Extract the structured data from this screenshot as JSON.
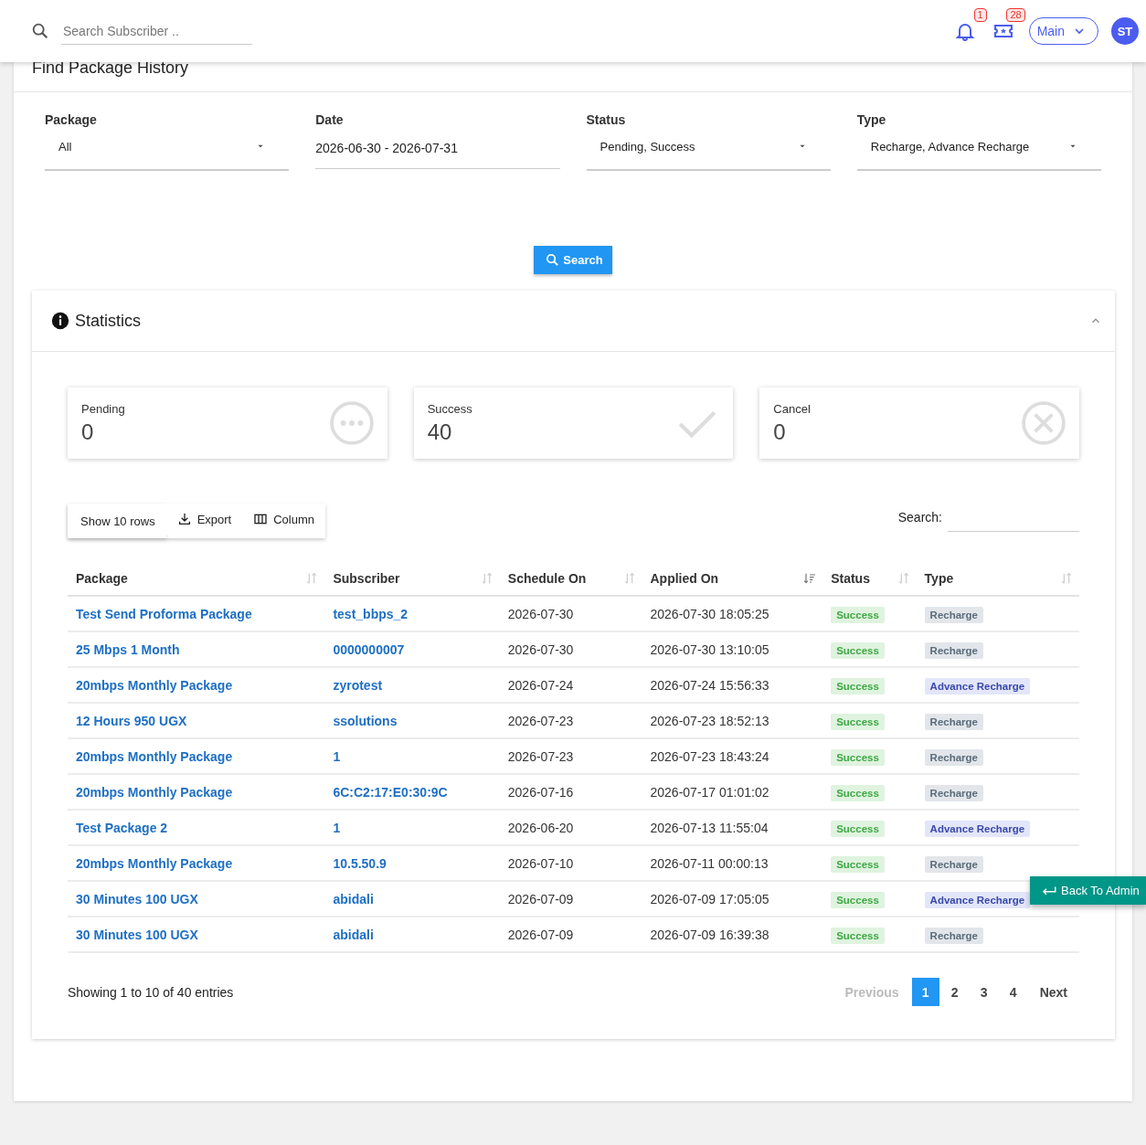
{
  "header": {
    "search": {
      "placeholder": "Search Subscriber .."
    },
    "notifications": "1",
    "tickets": "28",
    "menu": "Main",
    "avatar": "ST"
  },
  "card": {
    "title": "Find Package History"
  },
  "filters": [
    {
      "label": "Package",
      "value": "All",
      "kind": "select"
    },
    {
      "label": "Date",
      "value": "2026-06-30 - 2026-07-31",
      "kind": "text"
    },
    {
      "label": "Status",
      "value": "Pending, Success",
      "kind": "select"
    },
    {
      "label": "Type",
      "value": "Recharge, Advance Recharge",
      "kind": "select"
    }
  ],
  "search_button": "Search",
  "statistics": {
    "title": "Statistics",
    "expanded": true,
    "cards": [
      {
        "label": "Pending",
        "value": "0",
        "kind": "pending"
      },
      {
        "label": "Success",
        "value": "40",
        "kind": "success"
      },
      {
        "label": "Cancel",
        "value": "0",
        "kind": "cancel"
      }
    ]
  },
  "toolbar": {
    "rows": "Show 10 rows",
    "export": "Export",
    "column": "Column",
    "search_label": "Search:"
  },
  "table": {
    "columns": [
      {
        "label": "Package",
        "sorted": false
      },
      {
        "label": "Subscriber",
        "sorted": false
      },
      {
        "label": "Schedule On",
        "sorted": false
      },
      {
        "label": "Applied On",
        "sorted": true
      },
      {
        "label": "Status",
        "sorted": false
      },
      {
        "label": "Type",
        "sorted": false
      }
    ],
    "rows": [
      {
        "package": "Test Send Proforma Package",
        "subscriber": "test_bbps_2",
        "schedule": "2026-07-30",
        "applied": "2026-07-30 18:05:25",
        "status": "Success",
        "type": {
          "label": "Recharge",
          "kind": "recharge"
        }
      },
      {
        "package": "25 Mbps 1 Month",
        "subscriber": "0000000007",
        "schedule": "2026-07-30",
        "applied": "2026-07-30 13:10:05",
        "status": "Success",
        "type": {
          "label": "Recharge",
          "kind": "recharge"
        }
      },
      {
        "package": "20mbps Monthly Package",
        "subscriber": "zyrotest",
        "schedule": "2026-07-24",
        "applied": "2026-07-24 15:56:33",
        "status": "Success",
        "type": {
          "label": "Advance Recharge",
          "kind": "advance"
        }
      },
      {
        "package": "12 Hours 950 UGX",
        "subscriber": "ssolutions",
        "schedule": "2026-07-23",
        "applied": "2026-07-23 18:52:13",
        "status": "Success",
        "type": {
          "label": "Recharge",
          "kind": "recharge"
        }
      },
      {
        "package": "20mbps Monthly Package",
        "subscriber": "1",
        "schedule": "2026-07-23",
        "applied": "2026-07-23 18:43:24",
        "status": "Success",
        "type": {
          "label": "Recharge",
          "kind": "recharge"
        }
      },
      {
        "package": "20mbps Monthly Package",
        "subscriber": "6C:C2:17:E0:30:9C",
        "schedule": "2026-07-16",
        "applied": "2026-07-17 01:01:02",
        "status": "Success",
        "type": {
          "label": "Recharge",
          "kind": "recharge"
        }
      },
      {
        "package": "Test Package 2",
        "subscriber": "1",
        "schedule": "2026-06-20",
        "applied": "2026-07-13 11:55:04",
        "status": "Success",
        "type": {
          "label": "Advance Recharge",
          "kind": "advance"
        }
      },
      {
        "package": "20mbps Monthly Package",
        "subscriber": "10.5.50.9",
        "schedule": "2026-07-10",
        "applied": "2026-07-11 00:00:13",
        "status": "Success",
        "type": {
          "label": "Recharge",
          "kind": "recharge"
        }
      },
      {
        "package": "30 Minutes 100 UGX",
        "subscriber": "abidali",
        "schedule": "2026-07-09",
        "applied": "2026-07-09 17:05:05",
        "status": "Success",
        "type": {
          "label": "Advance Recharge",
          "kind": "advance"
        }
      },
      {
        "package": "30 Minutes 100 UGX",
        "subscriber": "abidali",
        "schedule": "2026-07-09",
        "applied": "2026-07-09 16:39:38",
        "status": "Success",
        "type": {
          "label": "Recharge",
          "kind": "recharge"
        }
      }
    ]
  },
  "footer": {
    "info": "Showing 1 to 10 of 40 entries",
    "pages": [
      {
        "label": "Previous",
        "kind": "prev",
        "disabled": true,
        "selected": false
      },
      {
        "label": "1",
        "kind": "page",
        "disabled": false,
        "selected": true
      },
      {
        "label": "2",
        "kind": "page",
        "disabled": false,
        "selected": false
      },
      {
        "label": "3",
        "kind": "page",
        "disabled": false,
        "selected": false
      },
      {
        "label": "4",
        "kind": "page",
        "disabled": false,
        "selected": false
      },
      {
        "label": "Next",
        "kind": "next",
        "disabled": false,
        "selected": false
      }
    ]
  },
  "back_button": "Back To Admin"
}
